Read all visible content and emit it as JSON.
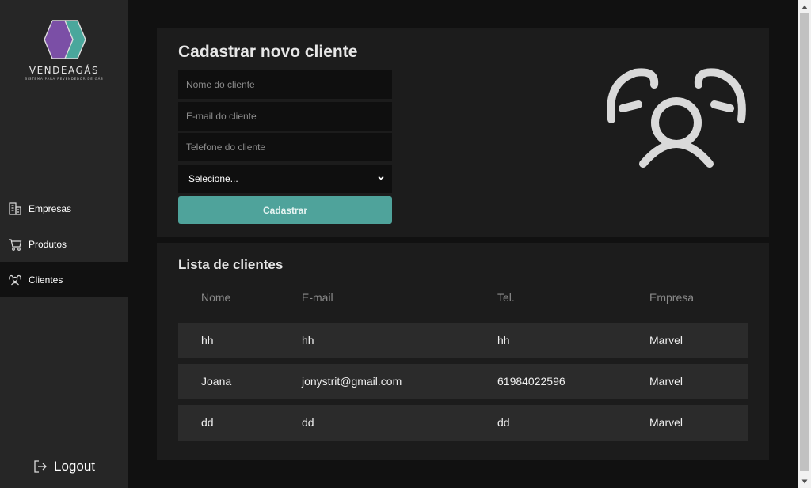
{
  "brand": {
    "name": "VENDEAGÁS",
    "tagline": "SISTEMA PARA REVENDEDOR DE GÁS"
  },
  "sidebar": {
    "items": [
      {
        "label": "Empresas",
        "icon": "building-icon",
        "active": false
      },
      {
        "label": "Produtos",
        "icon": "cart-icon",
        "active": false
      },
      {
        "label": "Clientes",
        "icon": "users-icon",
        "active": true
      }
    ],
    "logout_label": "Logout"
  },
  "form": {
    "title": "Cadastrar novo cliente",
    "name_placeholder": "Nome do cliente",
    "email_placeholder": "E-mail do cliente",
    "phone_placeholder": "Telefone do cliente",
    "company_select_value": "Selecione...",
    "submit_label": "Cadastrar"
  },
  "list": {
    "title": "Lista de clientes",
    "columns": [
      "Nome",
      "E-mail",
      "Tel.",
      "Empresa"
    ],
    "rows": [
      [
        "hh",
        "hh",
        "hh",
        "Marvel"
      ],
      [
        "Joana",
        "jonystrit@gmail.com",
        "61984022596",
        "Marvel"
      ],
      [
        "dd",
        "dd",
        "dd",
        "Marvel"
      ]
    ]
  },
  "colors": {
    "accent": "#4fa39b",
    "sidebar_bg": "#262626",
    "page_bg": "#111111",
    "card_bg": "#1c1c1c",
    "logo_purple": "#7b4fa6",
    "logo_teal": "#4aa79c"
  }
}
